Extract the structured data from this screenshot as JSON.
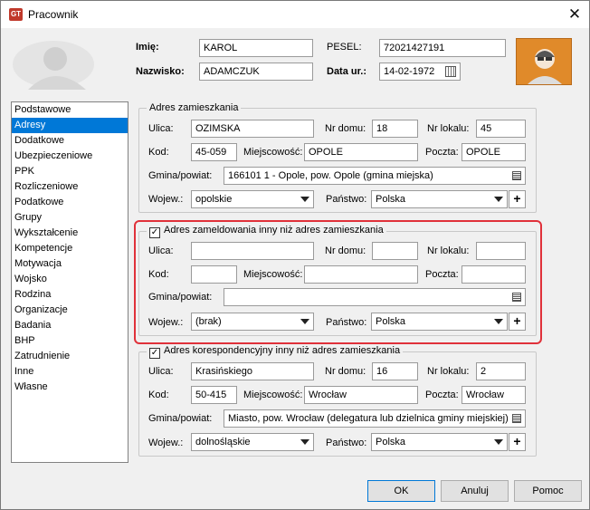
{
  "window": {
    "title": "Pracownik",
    "close_label": "✕",
    "app_icon_text": "GT"
  },
  "header": {
    "imie_label": "Imię:",
    "imie_value": "KAROL",
    "nazwisko_label": "Nazwisko:",
    "nazwisko_value": "ADAMCZUK",
    "pesel_label": "PESEL:",
    "pesel_value": "72021427191",
    "data_label": "Data ur.:",
    "data_value": "14-02-1972"
  },
  "sidebar": {
    "items": [
      "Podstawowe",
      "Adresy",
      "Dodatkowe",
      "Ubezpieczeniowe",
      "PPK",
      "Rozliczeniowe",
      "Podatkowe",
      "Grupy",
      "Wykształcenie",
      "Kompetencje",
      "Motywacja",
      "Wojsko",
      "Rodzina",
      "Organizacje",
      "Badania",
      "BHP",
      "Zatrudnienie",
      "Inne",
      "Własne"
    ],
    "active": "Adresy"
  },
  "labels": {
    "ulica": "Ulica:",
    "nr_domu": "Nr domu:",
    "nr_lokalu": "Nr lokalu:",
    "kod": "Kod:",
    "miejscowosc": "Miejscowość:",
    "poczta": "Poczta:",
    "gmina": "Gmina/powiat:",
    "wojew": "Wojew.:",
    "panstwo": "Państwo:",
    "plus": "+"
  },
  "address1": {
    "title": "Adres zamieszkania",
    "ulica": "OZIMSKA",
    "nr_domu": "18",
    "nr_lokalu": "45",
    "kod": "45-059",
    "miejscowosc": "OPOLE",
    "poczta": "OPOLE",
    "gmina": "166101 1 - Opole, pow. Opole (gmina miejska)",
    "wojew": "opolskie",
    "panstwo": "Polska"
  },
  "address2": {
    "title": "Adres zameldowania inny niż adres zamieszkania",
    "checked": "✓",
    "ulica": "",
    "nr_domu": "",
    "nr_lokalu": "",
    "kod": "",
    "miejscowosc": "",
    "poczta": "",
    "gmina": "",
    "wojew": "(brak)",
    "panstwo": "Polska"
  },
  "address3": {
    "title": "Adres korespondencyjny inny niż adres zamieszkania",
    "checked": "✓",
    "ulica": "Krasińskiego",
    "nr_domu": "16",
    "nr_lokalu": "2",
    "kod": "50-415",
    "miejscowosc": "Wrocław",
    "poczta": "Wrocław",
    "gmina": "Miasto, pow. Wrocław (delegatura lub dzielnica gminy miejskiej)",
    "wojew": "dolnośląskie",
    "panstwo": "Polska"
  },
  "buttons": {
    "ok": "OK",
    "cancel": "Anuluj",
    "help": "Pomoc"
  },
  "colors": {
    "highlight": "#e0313a",
    "selection": "#0078d7",
    "avatar": "#e08a2a"
  }
}
